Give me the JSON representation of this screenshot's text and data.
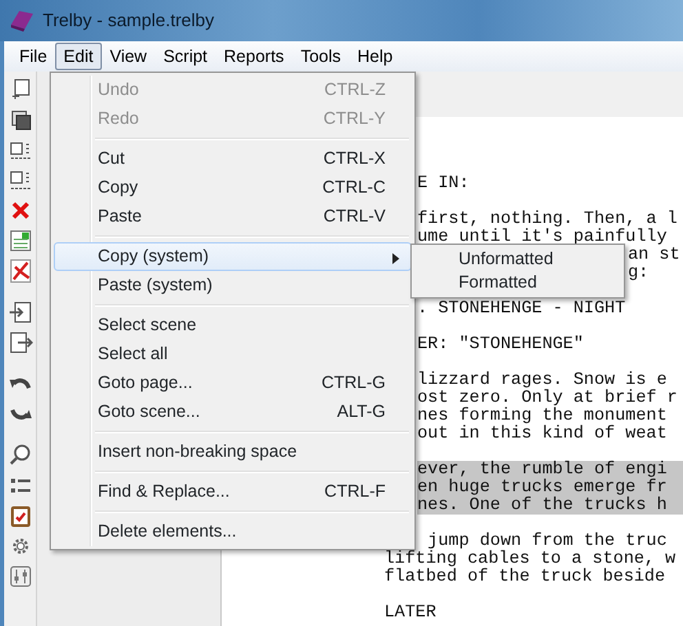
{
  "window": {
    "title": "Trelby - sample.trelby"
  },
  "menu_bar": [
    {
      "label": "File",
      "selected": false
    },
    {
      "label": "Edit",
      "selected": true
    },
    {
      "label": "View",
      "selected": false
    },
    {
      "label": "Script",
      "selected": false
    },
    {
      "label": "Reports",
      "selected": false
    },
    {
      "label": "Tools",
      "selected": false
    },
    {
      "label": "Help",
      "selected": false
    }
  ],
  "edit_menu": [
    {
      "kind": "item",
      "label": "Undo",
      "shortcut": "CTRL-Z",
      "disabled": true,
      "selected": false
    },
    {
      "kind": "item",
      "label": "Redo",
      "shortcut": "CTRL-Y",
      "disabled": true,
      "selected": false
    },
    {
      "kind": "separator"
    },
    {
      "kind": "item",
      "label": "Cut",
      "shortcut": "CTRL-X",
      "disabled": false,
      "selected": false
    },
    {
      "kind": "item",
      "label": "Copy",
      "shortcut": "CTRL-C",
      "disabled": false,
      "selected": false
    },
    {
      "kind": "item",
      "label": "Paste",
      "shortcut": "CTRL-V",
      "disabled": false,
      "selected": false
    },
    {
      "kind": "separator"
    },
    {
      "kind": "submenu",
      "label": "Copy (system)",
      "disabled": false,
      "selected": true
    },
    {
      "kind": "item",
      "label": "Paste (system)",
      "disabled": false,
      "selected": false
    },
    {
      "kind": "separator"
    },
    {
      "kind": "item",
      "label": "Select scene",
      "disabled": false,
      "selected": false
    },
    {
      "kind": "item",
      "label": "Select all",
      "disabled": false,
      "selected": false
    },
    {
      "kind": "item",
      "label": "Goto page...",
      "shortcut": "CTRL-G",
      "disabled": false,
      "selected": false
    },
    {
      "kind": "item",
      "label": "Goto scene...",
      "shortcut": "ALT-G",
      "disabled": false,
      "selected": false
    },
    {
      "kind": "separator"
    },
    {
      "kind": "item",
      "label": "Insert non-breaking space",
      "disabled": false,
      "selected": false
    },
    {
      "kind": "separator"
    },
    {
      "kind": "item",
      "label": "Find & Replace...",
      "shortcut": "CTRL-F",
      "disabled": false,
      "selected": false
    },
    {
      "kind": "separator"
    },
    {
      "kind": "item",
      "label": "Delete elements...",
      "disabled": false,
      "selected": false
    }
  ],
  "copy_submenu": [
    {
      "label": "Unformatted"
    },
    {
      "label": "Formatted"
    }
  ],
  "script_lines": [
    {
      "text": "E IN:",
      "kind": "cut",
      "gap_before": false,
      "highlighted": false
    },
    {
      "text": "first, nothing. Then, a l",
      "kind": "cut",
      "gap_before": true,
      "highlighted": false
    },
    {
      "text": "ume until it's painfully",
      "kind": "cut",
      "gap_before": false,
      "highlighted": false
    },
    {
      "text": "an st",
      "kind": "beside_submenu",
      "gap_before": false,
      "highlighted": false
    },
    {
      "text": "g:",
      "kind": "beside_submenu",
      "gap_before": false,
      "highlighted": false
    },
    {
      "text": ". STONEHENGE - NIGHT",
      "kind": "cut",
      "gap_before": true,
      "highlighted": false
    },
    {
      "text": "ER: \"STONEHENGE\"",
      "kind": "cut",
      "gap_before": true,
      "highlighted": false
    },
    {
      "text": "lizzard rages. Snow is e",
      "kind": "cut",
      "gap_before": true,
      "highlighted": false
    },
    {
      "text": "ost zero. Only at brief r",
      "kind": "cut",
      "gap_before": false,
      "highlighted": false
    },
    {
      "text": "nes forming the monument",
      "kind": "cut",
      "gap_before": false,
      "highlighted": false
    },
    {
      "text": "out in this kind of weat",
      "kind": "cut",
      "gap_before": false,
      "highlighted": false
    },
    {
      "text": "ever, the rumble of engi",
      "kind": "cut",
      "gap_before": true,
      "highlighted": true
    },
    {
      "text": "en huge trucks emerge fr",
      "kind": "cut",
      "gap_before": false,
      "highlighted": true
    },
    {
      "text": "nes. One of the trucks h",
      "kind": "cut",
      "gap_before": false,
      "highlighted": true
    },
    {
      "text": " jump down from the truc",
      "kind": "cut",
      "gap_before": true,
      "highlighted": false
    },
    {
      "text": "lifting cables to a stone, w",
      "kind": "full",
      "gap_before": false,
      "highlighted": false
    },
    {
      "text": "flatbed of the truck beside",
      "kind": "full",
      "gap_before": false,
      "highlighted": false
    },
    {
      "text": "LATER",
      "kind": "full",
      "gap_before": true,
      "highlighted": false
    }
  ]
}
